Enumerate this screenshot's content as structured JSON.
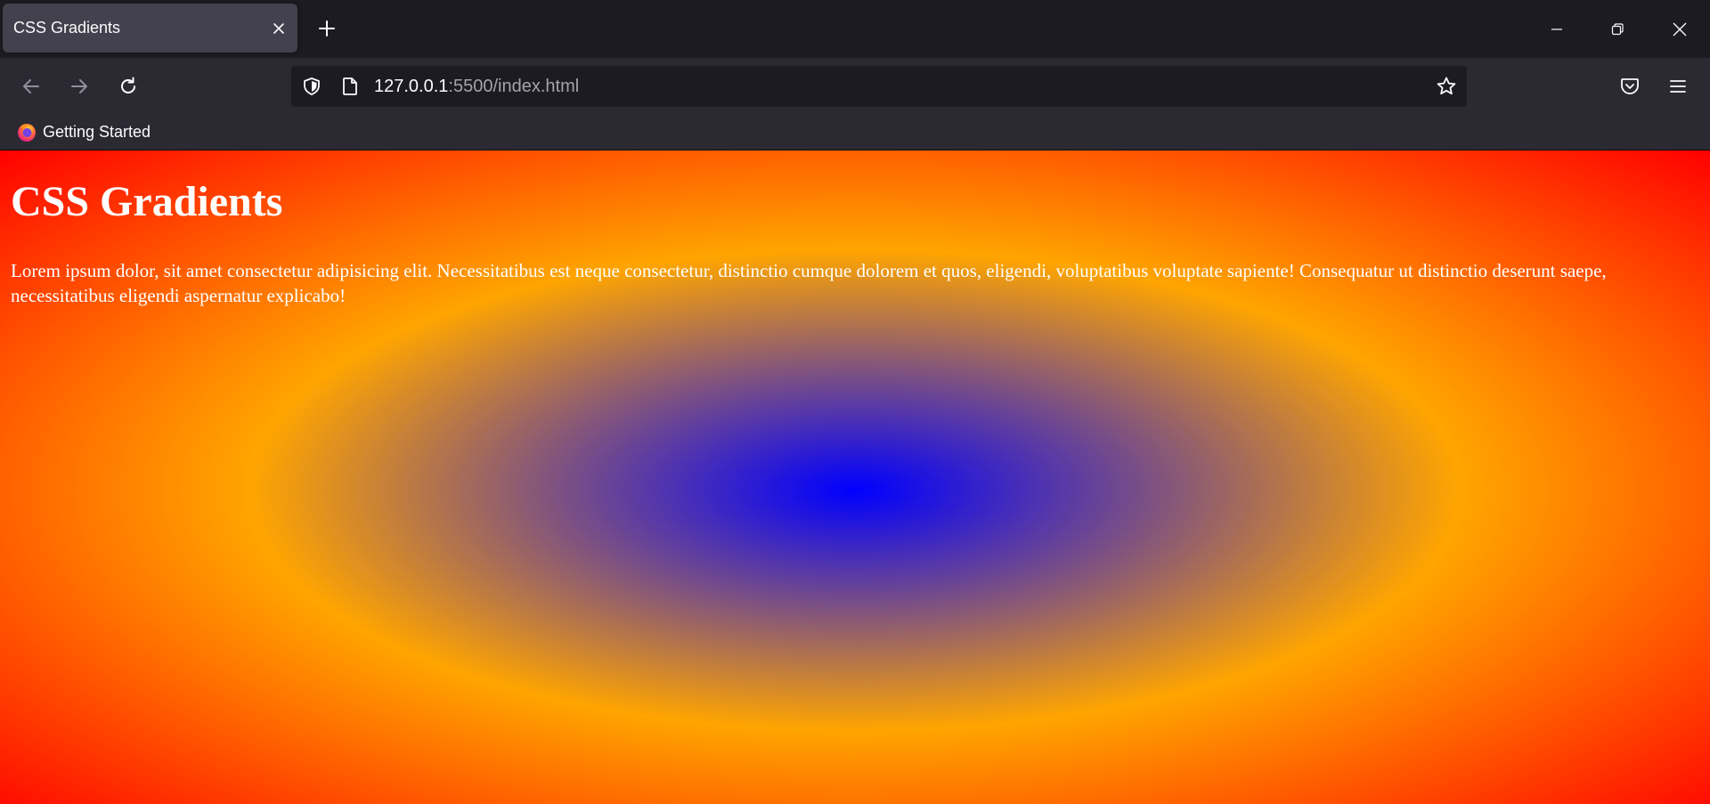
{
  "browser": {
    "tab": {
      "title": "CSS Gradients"
    },
    "url": {
      "host": "127.0.0.1",
      "rest": ":5500/index.html"
    },
    "bookmarks": [
      {
        "label": "Getting Started"
      }
    ]
  },
  "page": {
    "heading": "CSS Gradients",
    "paragraph": "Lorem ipsum dolor, sit amet consectetur adipisicing elit. Necessitatibus est neque consectetur, distinctio cumque dolorem et quos, eligendi, voluptatibus voluptate sapiente! Consequatur ut distinctio deserunt saepe, necessitatibus eligendi aspernatur explicabo!",
    "gradient": {
      "type": "radial",
      "colors": [
        "#0000ff",
        "#ffa500",
        "#ff0000"
      ]
    }
  },
  "theme": {
    "chrome_dark": "#1c1b22",
    "toolbar": "#2b2a33",
    "tab_active": "#42414d",
    "text": "#fbfbfe"
  }
}
